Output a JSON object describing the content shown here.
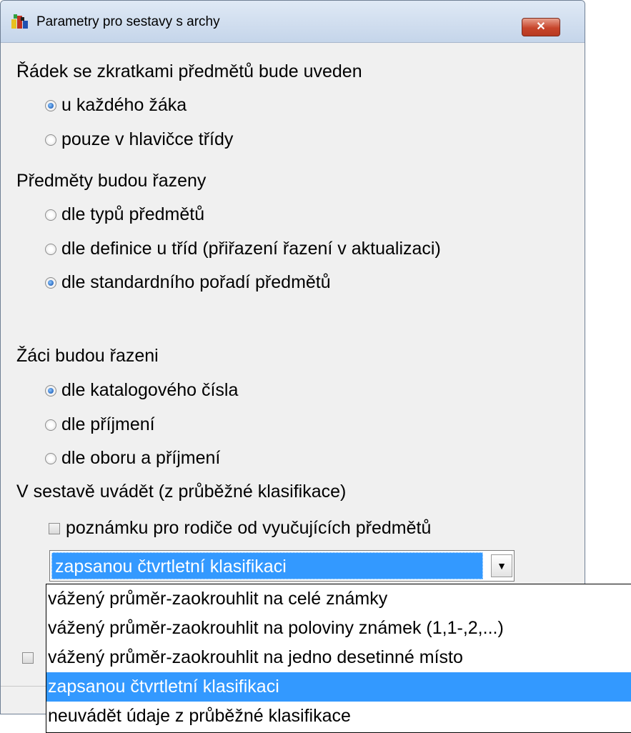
{
  "window": {
    "title": "Parametry pro sestavy s archy",
    "close_label": "✕"
  },
  "section1": {
    "title": "Řádek se zkratkami předmětů bude uveden",
    "options": [
      "u každého žáka",
      "pouze v hlavičce třídy"
    ],
    "selected": 0
  },
  "section2": {
    "title": "Předměty budou řazeny",
    "options": [
      "dle typů předmětů",
      "dle definice u tříd (přiřazení řazení v aktualizaci)",
      "dle standardního pořadí předmětů"
    ],
    "selected": 2
  },
  "section3": {
    "title": "Žáci budou řazeni",
    "options": [
      "dle katalogového čísla",
      "dle příjmení",
      "dle oboru a příjmení"
    ],
    "selected": 0
  },
  "section4": {
    "title": "V sestavě uvádět (z průběžné klasifikace)",
    "checkbox_label": "poznámku pro rodiče od vyučujících předmětů",
    "checkbox_checked": false
  },
  "combo": {
    "selected_value": "zapsanou čtvrtletní klasifikaci",
    "arrow": "▼",
    "options": [
      "vážený průměr-zaokrouhlit na celé známky",
      "vážený průměr-zaokrouhlit na poloviny známek (1,1-,2,...)",
      "vážený průměr-zaokrouhlit na jedno desetinné místo",
      "zapsanou čtvrtletní klasifikaci",
      "neuvádět údaje z průběžné klasifikace"
    ],
    "selected_index": 3
  },
  "colors": {
    "selection": "#3399ff",
    "window_bg": "#f0f0f0",
    "close_button": "#c7452b"
  }
}
